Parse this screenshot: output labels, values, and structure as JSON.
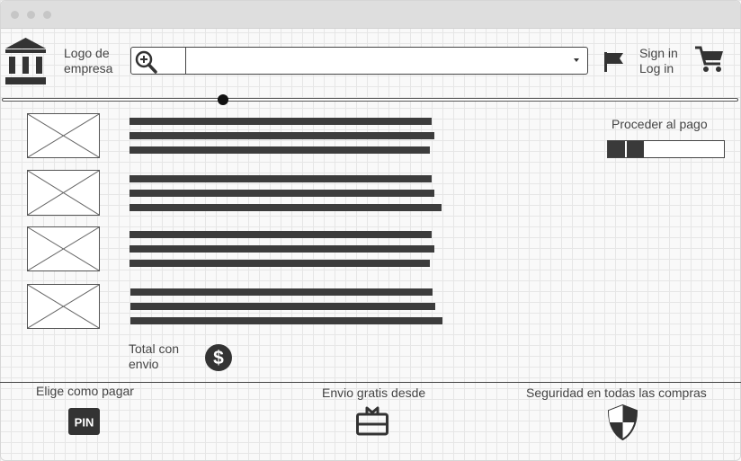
{
  "header": {
    "logo_text": [
      "Logo de",
      "empresa"
    ],
    "search": {
      "value": "",
      "placeholder": ""
    },
    "sign_in": "Sign in",
    "log_in": "Log in"
  },
  "slider": {
    "value": 0.3
  },
  "products": [
    {
      "image": "image-placeholder"
    },
    {
      "image": "image-placeholder"
    },
    {
      "image": "image-placeholder"
    },
    {
      "image": "image-placeholder"
    }
  ],
  "total_label": [
    "Total con",
    "envio"
  ],
  "checkout": {
    "label": "Proceder al pago",
    "progress": 0.31
  },
  "footer": {
    "payment_label": "Elige como pagar",
    "shipping_label": "Envio gratis desde",
    "security_label": "Seguridad en todas las compras",
    "pin_text": "PIN"
  },
  "icons": {
    "logo": "bank-icon",
    "search": "zoom-in-icon",
    "flag": "flag-icon",
    "cart": "cart-icon",
    "currency": "dollar-icon",
    "payment": "pin-icon",
    "shipping": "gift-icon",
    "security": "shield-icon"
  }
}
